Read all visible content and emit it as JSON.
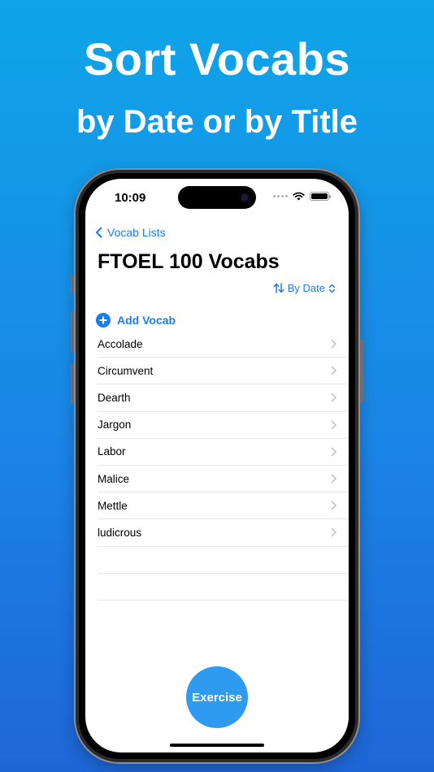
{
  "promo": {
    "headline": "Sort Vocabs",
    "subheadline": "by Date or by Title"
  },
  "status_bar": {
    "time": "10:09"
  },
  "nav": {
    "back_label": "Vocab Lists"
  },
  "page": {
    "title": "FTOEL 100 Vocabs"
  },
  "sort": {
    "label": "By Date"
  },
  "add": {
    "label": "Add Vocab"
  },
  "vocabs": [
    {
      "word": "Accolade"
    },
    {
      "word": "Circumvent"
    },
    {
      "word": "Dearth"
    },
    {
      "word": "Jargon"
    },
    {
      "word": "Labor"
    },
    {
      "word": "Malice"
    },
    {
      "word": "Mettle"
    },
    {
      "word": "ludicrous"
    }
  ],
  "exercise": {
    "label": "Exercise"
  },
  "colors": {
    "accent": "#1a7cf0",
    "exercise_button": "#2f9bf0",
    "background_top": "#0ea5e9",
    "background_bottom": "#1e66d8"
  }
}
